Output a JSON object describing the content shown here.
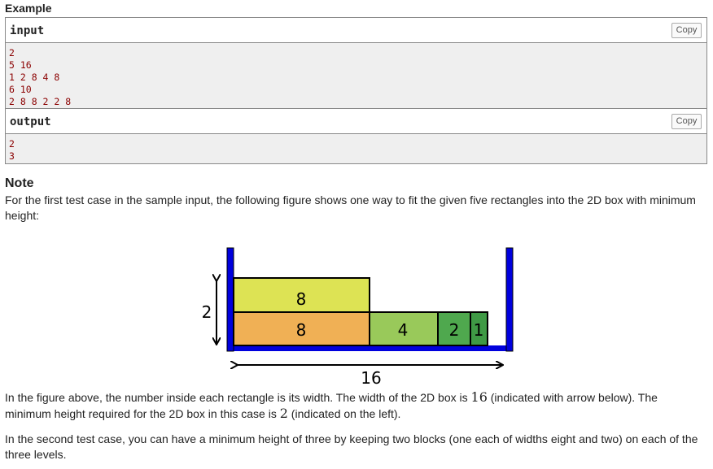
{
  "example": {
    "title": "Example",
    "input": {
      "label": "input",
      "copy_label": "Copy",
      "lines": [
        "2",
        "5 16",
        "1 2 8 4 8",
        "6 10",
        "2 8 8 2 2 8"
      ]
    },
    "output": {
      "label": "output",
      "copy_label": "Copy",
      "lines": [
        "2",
        "3"
      ]
    }
  },
  "note": {
    "title": "Note",
    "intro": "For the first test case in the sample input, the following figure shows one way to fit the given five rectangles into the 2D box with minimum height:",
    "figure": {
      "height_label": "2",
      "width_label": "16",
      "top_row": [
        "8"
      ],
      "bottom_row": [
        "8",
        "4",
        "2",
        "1"
      ],
      "colors": {
        "box": "#0000dd",
        "rect_8_top": "#dde354",
        "rect_8_bottom": "#f0b055",
        "rect_4": "#99c95a",
        "rect_2": "#4fa84e",
        "rect_1": "#3f9a45"
      }
    },
    "para2": {
      "part1": "In the figure above, the number inside each rectangle is its width. The width of the 2D box is ",
      "width_value": "16",
      "part2": " (indicated with arrow below). The minimum height required for the 2D box in this case is ",
      "height_value": "2",
      "part3": " (indicated on the left)."
    },
    "para3": "In the second test case, you can have a minimum height of three by keeping two blocks (one each of widths eight and two) on each of the three levels."
  }
}
